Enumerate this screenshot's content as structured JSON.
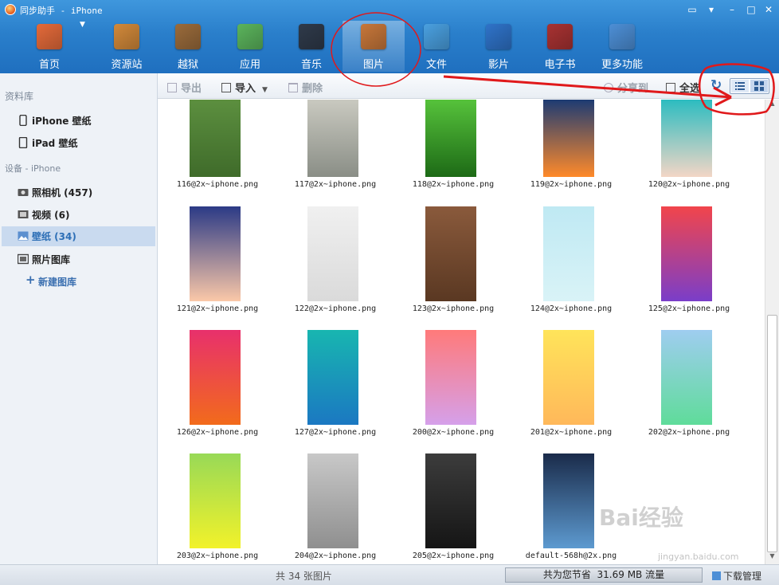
{
  "window": {
    "title": "同步助手 - iPhone"
  },
  "nav": [
    {
      "label": "首页",
      "icon": "home-icon",
      "color": "#e46a3a"
    },
    {
      "label": "资源站",
      "icon": "shopping-bag-icon",
      "color": "#d2893a"
    },
    {
      "label": "越狱",
      "icon": "pineapple-icon",
      "color": "#9a6b3b"
    },
    {
      "label": "应用",
      "icon": "apps-icon",
      "color": "#5bb45c"
    },
    {
      "label": "音乐",
      "icon": "music-note-icon",
      "color": "#2f3a4a"
    },
    {
      "label": "图片",
      "icon": "photo-icon",
      "color": "#c7773a"
    },
    {
      "label": "文件",
      "icon": "folder-sync-icon",
      "color": "#4aa0e0"
    },
    {
      "label": "影片",
      "icon": "video-play-icon",
      "color": "#2f73c9"
    },
    {
      "label": "电子书",
      "icon": "ebook-icon",
      "color": "#a83232"
    },
    {
      "label": "更多功能",
      "icon": "tools-icon",
      "color": "#4d8fd6"
    }
  ],
  "sidebar": {
    "library_title": "资料库",
    "library": [
      {
        "label": "iPhone 壁纸"
      },
      {
        "label": "iPad 壁纸"
      }
    ],
    "device_title": "设备 - iPhone",
    "device": [
      {
        "label": "照相机 (457)"
      },
      {
        "label": "视频 (6)"
      },
      {
        "label": "壁纸 (34)"
      },
      {
        "label": "照片图库"
      },
      {
        "label": "新建图库"
      }
    ]
  },
  "toolbar": {
    "export": "导出",
    "import": "导入",
    "delete": "删除",
    "share": "分享到",
    "select_all": "全选"
  },
  "photos": [
    {
      "name": "116@2x~iphone.png",
      "c": [
        "#5c8f3f",
        "#3f6b2a"
      ]
    },
    {
      "name": "117@2x~iphone.png",
      "c": [
        "#c9c9c0",
        "#8a8e86"
      ]
    },
    {
      "name": "118@2x~iphone.png",
      "c": [
        "#56c23b",
        "#1d6a16"
      ]
    },
    {
      "name": "119@2x~iphone.png",
      "c": [
        "#1d3b73",
        "#ff8a2a"
      ]
    },
    {
      "name": "120@2x~iphone.png",
      "c": [
        "#2cbcc0",
        "#f3d6c6"
      ]
    },
    {
      "name": "121@2x~iphone.png",
      "c": [
        "#2b3a86",
        "#fbc8a8"
      ]
    },
    {
      "name": "122@2x~iphone.png",
      "c": [
        "#f0f0f0",
        "#dadada"
      ]
    },
    {
      "name": "123@2x~iphone.png",
      "c": [
        "#8a5a3c",
        "#5a3822"
      ]
    },
    {
      "name": "124@2x~iphone.png",
      "c": [
        "#bfe9f3",
        "#d9f3f7"
      ]
    },
    {
      "name": "125@2x~iphone.png",
      "c": [
        "#f2454b",
        "#7a3ec9"
      ]
    },
    {
      "name": "126@2x~iphone.png",
      "c": [
        "#e8306c",
        "#f26b1b"
      ]
    },
    {
      "name": "127@2x~iphone.png",
      "c": [
        "#18b6b0",
        "#1b78c2"
      ]
    },
    {
      "name": "200@2x~iphone.png",
      "c": [
        "#ff7a7a",
        "#d5a0ea"
      ]
    },
    {
      "name": "201@2x~iphone.png",
      "c": [
        "#ffe45a",
        "#ffb85a"
      ]
    },
    {
      "name": "202@2x~iphone.png",
      "c": [
        "#9fcdf0",
        "#5fdc9a"
      ]
    },
    {
      "name": "203@2x~iphone.png",
      "c": [
        "#98d957",
        "#f2f22a"
      ]
    },
    {
      "name": "204@2x~iphone.png",
      "c": [
        "#c8c8c8",
        "#8f8f8f"
      ]
    },
    {
      "name": "205@2x~iphone.png",
      "c": [
        "#3c3c3c",
        "#151515"
      ]
    },
    {
      "name": "default-568h@2x.png",
      "c": [
        "#1a2b4a",
        "#5d9ad0"
      ]
    }
  ],
  "status": {
    "count": "共 34 张图片",
    "savings": "共为您节省  31.69 MB 流量",
    "download": "下载管理"
  },
  "watermark": {
    "text": "Bai经验",
    "sub": "jingyan.baidu.com"
  }
}
